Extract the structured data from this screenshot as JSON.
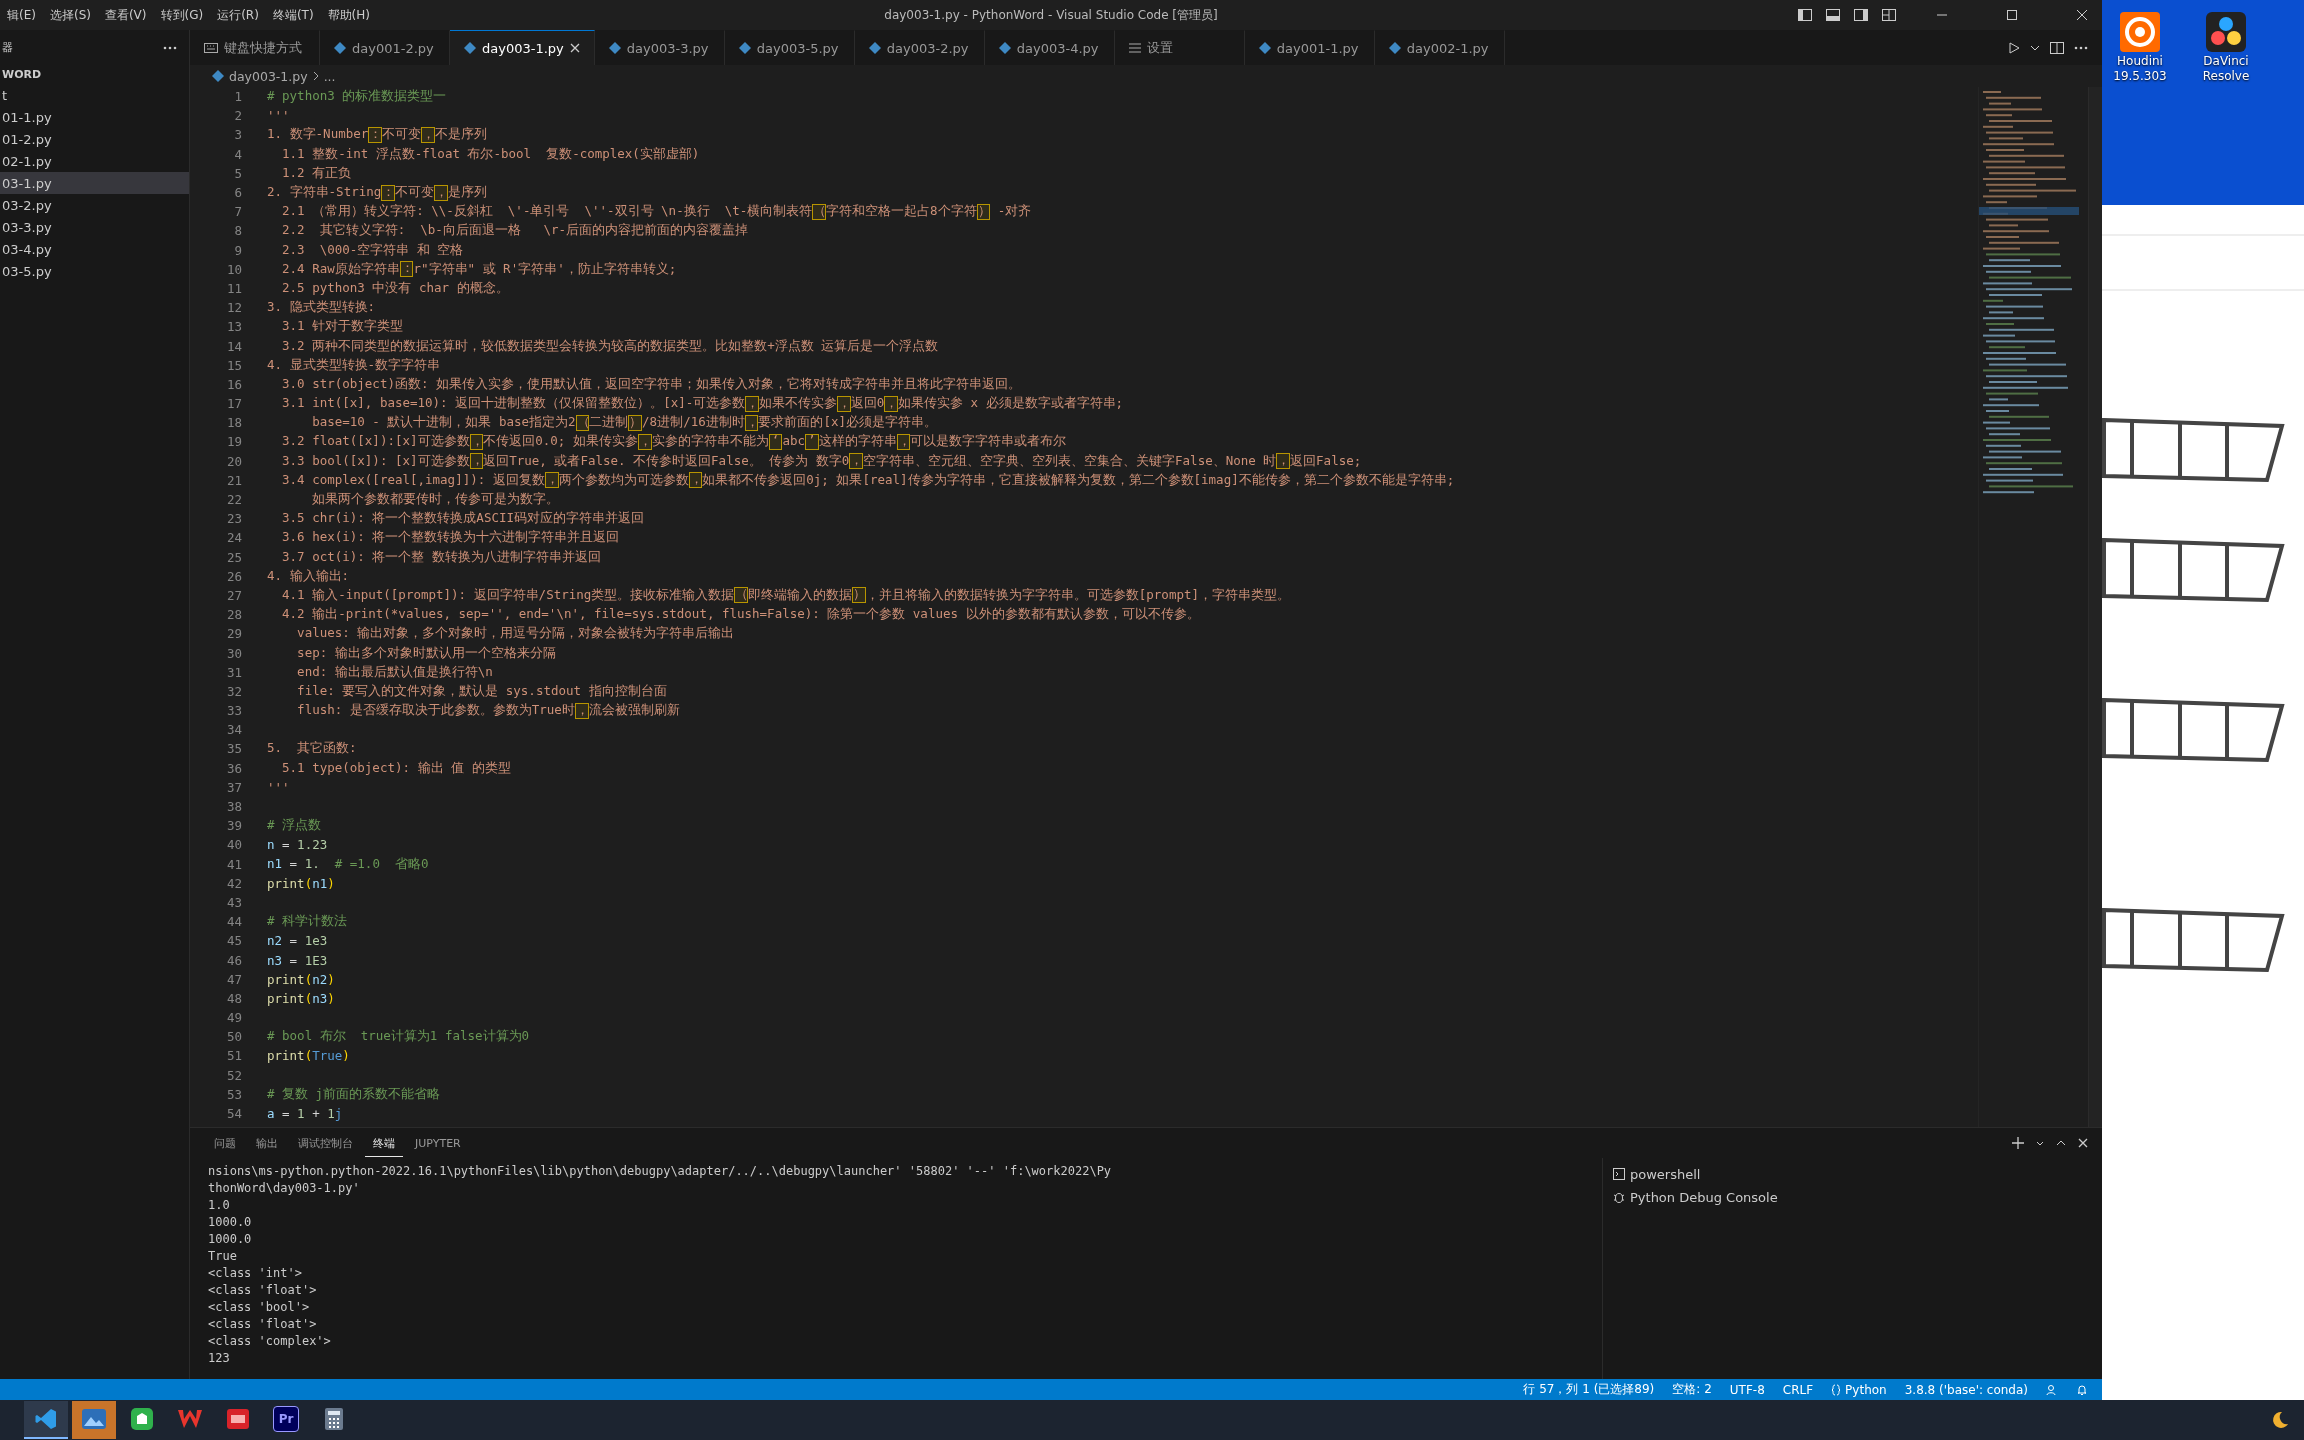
{
  "titlebar": {
    "menu": [
      "辑(E)",
      "选择(S)",
      "查看(V)",
      "转到(G)",
      "运行(R)",
      "终端(T)",
      "帮助(H)"
    ],
    "title": "day003-1.py - PythonWord - Visual Studio Code [管理员]"
  },
  "sidebar": {
    "header": "器",
    "folder": "WORD",
    "items": [
      {
        "label": "t",
        "selected": false
      },
      {
        "label": "01-1.py",
        "selected": false
      },
      {
        "label": "01-2.py",
        "selected": false
      },
      {
        "label": "02-1.py",
        "selected": false
      },
      {
        "label": "03-1.py",
        "selected": true
      },
      {
        "label": "03-2.py",
        "selected": false
      },
      {
        "label": "03-3.py",
        "selected": false
      },
      {
        "label": "03-4.py",
        "selected": false
      },
      {
        "label": "03-5.py",
        "selected": false
      }
    ]
  },
  "tabs": [
    {
      "label": "键盘快捷方式",
      "kind": "keyboard",
      "selected": false
    },
    {
      "label": "day001-2.py",
      "kind": "python",
      "selected": false
    },
    {
      "label": "day003-1.py",
      "kind": "python",
      "selected": true
    },
    {
      "label": "day003-3.py",
      "kind": "python",
      "selected": false
    },
    {
      "label": "day003-5.py",
      "kind": "python",
      "selected": false
    },
    {
      "label": "day003-2.py",
      "kind": "python",
      "selected": false
    },
    {
      "label": "day003-4.py",
      "kind": "python",
      "selected": false
    },
    {
      "label": "设置",
      "kind": "settings",
      "selected": false
    },
    {
      "label": "day001-1.py",
      "kind": "python",
      "selected": false
    },
    {
      "label": "day002-1.py",
      "kind": "python",
      "selected": false
    }
  ],
  "breadcrumb": {
    "file": "day003-1.py",
    "rest": "..."
  },
  "editor": {
    "lines": [
      {
        "num": "1",
        "kind": "comment",
        "tokens": [
          {
            "kind": "comment",
            "text": "# python3 的标准数据类型一"
          }
        ]
      },
      {
        "num": "2",
        "kind": "docstring",
        "tokens": [
          {
            "kind": "text",
            "text": "'''"
          }
        ]
      },
      {
        "num": "3",
        "kind": "docstring",
        "tokens": [
          {
            "kind": "text",
            "text": "1. 数字-Number"
          },
          {
            "kind": "lead_mark",
            "text": "：不可变"
          },
          {
            "kind": "lead_mark",
            "text": "，不是序列"
          }
        ]
      },
      {
        "num": "4",
        "kind": "docstring",
        "tokens": [
          {
            "kind": "text",
            "text": "  1.1 整数-int 浮点数-float 布尔-bool  复数-complex(实部虚部)"
          }
        ]
      },
      {
        "num": "5",
        "kind": "docstring",
        "tokens": [
          {
            "kind": "text",
            "text": "  1.2 有正负"
          }
        ]
      },
      {
        "num": "6",
        "kind": "docstring",
        "tokens": [
          {
            "kind": "text",
            "text": "2. 字符串-String"
          },
          {
            "kind": "lead_mark",
            "text": "：不可变"
          },
          {
            "kind": "lead_mark",
            "text": "，是序列"
          }
        ]
      },
      {
        "num": "7",
        "kind": "docstring",
        "tokens": [
          {
            "kind": "text",
            "text": "  2.1 （常用）转义字符: \\\\-反斜杠  \\'-单引号  \\''-双引号 \\n-换行  \\t-横向制表符"
          },
          {
            "kind": "lead_mark",
            "text": "（字符和空格一起占8个字符"
          },
          {
            "kind": "lead_mark",
            "text": "） -对齐"
          }
        ]
      },
      {
        "num": "8",
        "kind": "docstring",
        "tokens": [
          {
            "kind": "text",
            "text": "  2.2  其它转义字符:  \\b-向后面退一格   \\r-后面的内容把前面的内容覆盖掉"
          }
        ]
      },
      {
        "num": "9",
        "kind": "docstring",
        "tokens": [
          {
            "kind": "text",
            "text": "  2.3  \\000-空字符串 和 空格"
          }
        ]
      },
      {
        "num": "10",
        "kind": "docstring",
        "tokens": [
          {
            "kind": "text",
            "text": "  2.4 Raw原始字符串"
          },
          {
            "kind": "lead_mark",
            "text": "：r\"字符串\" 或 R'字符串'，防止字符串转义;"
          }
        ]
      },
      {
        "num": "11",
        "kind": "docstring",
        "tokens": [
          {
            "kind": "text",
            "text": "  2.5 python3 中没有 char 的概念。"
          }
        ]
      },
      {
        "num": "12",
        "kind": "docstring",
        "tokens": [
          {
            "kind": "text",
            "text": "3. 隐式类型转换:"
          }
        ]
      },
      {
        "num": "13",
        "kind": "docstring",
        "tokens": [
          {
            "kind": "text",
            "text": "  3.1 针对于数字类型"
          }
        ]
      },
      {
        "num": "14",
        "kind": "docstring",
        "tokens": [
          {
            "kind": "text",
            "text": "  3.2 两种不同类型的数据运算时，较低数据类型会转换为较高的数据类型。比如整数+浮点数 运算后是一个浮点数"
          }
        ]
      },
      {
        "num": "15",
        "kind": "docstring",
        "tokens": [
          {
            "kind": "text",
            "text": "4. 显式类型转换-数字字符串"
          }
        ]
      },
      {
        "num": "16",
        "kind": "docstring",
        "tokens": [
          {
            "kind": "text",
            "text": "  3.0 str(object)函数: 如果传入实参，使用默认值，返回空字符串；如果传入对象，它将对转成字符串并且将此字符串返回。"
          }
        ]
      },
      {
        "num": "17",
        "kind": "docstring",
        "tokens": [
          {
            "kind": "text",
            "text": "  3.1 int([x], base=10): 返回十进制整数（仅保留整数位）。[x]-可选参数"
          },
          {
            "kind": "lead_mark",
            "text": "，如果不传实参"
          },
          {
            "kind": "lead_mark",
            "text": "，返回0"
          },
          {
            "kind": "lead_mark",
            "text": "，如果传实参 x 必须是数字或者字符串;"
          }
        ]
      },
      {
        "num": "18",
        "kind": "docstring",
        "tokens": [
          {
            "kind": "text",
            "text": "      base=10 - 默认十进制，如果 base指定为2"
          },
          {
            "kind": "lead_mark",
            "text": "（二进制"
          },
          {
            "kind": "lead_mark",
            "text": "）/8进制/16进制时"
          },
          {
            "kind": "lead_mark",
            "text": "，要求前面的[x]必须是字符串。"
          }
        ]
      },
      {
        "num": "19",
        "kind": "docstring",
        "tokens": [
          {
            "kind": "text",
            "text": "  3.2 float([x]):[x]可选参数"
          },
          {
            "kind": "lead_mark",
            "text": "，不传返回0.0; 如果传实参"
          },
          {
            "kind": "lead_mark",
            "text": "，实参的字符串不能为"
          },
          {
            "kind": "lead_mark",
            "text": "‘abc"
          },
          {
            "kind": "lead_mark",
            "text": "’这样的字符串"
          },
          {
            "kind": "lead_mark",
            "text": "，可以是数字字符串或者布尔"
          }
        ]
      },
      {
        "num": "20",
        "kind": "docstring",
        "tokens": [
          {
            "kind": "text",
            "text": "  3.3 bool([x]): [x]可选参数"
          },
          {
            "kind": "lead_mark",
            "text": "，返回True, 或者False. 不传参时返回False。 传参为 数字0"
          },
          {
            "kind": "lead_mark",
            "text": "，空字符串、空元组、空字典、空列表、空集合、关键字False、None 时"
          },
          {
            "kind": "lead_mark",
            "text": "，返回False;"
          }
        ]
      },
      {
        "num": "21",
        "kind": "docstring",
        "tokens": [
          {
            "kind": "text",
            "text": "  3.4 complex([real[,imag]]): 返回复数"
          },
          {
            "kind": "lead_mark",
            "text": "，两个参数均为可选参数"
          },
          {
            "kind": "lead_mark",
            "text": "，如果都不传参返回0j; 如果[real]传参为字符串，它直接被解释为复数，第二个参数[imag]不能传参，第二个参数不能是字符串;"
          }
        ]
      },
      {
        "num": "22",
        "kind": "docstring",
        "tokens": [
          {
            "kind": "text",
            "text": "      如果两个参数都要传时，传参可是为数字。"
          }
        ]
      },
      {
        "num": "23",
        "kind": "docstring",
        "tokens": [
          {
            "kind": "text",
            "text": "  3.5 chr(i): 将一个整数转换成ASCII码对应的字符串并返回"
          }
        ]
      },
      {
        "num": "24",
        "kind": "docstring",
        "tokens": [
          {
            "kind": "text",
            "text": "  3.6 hex(i): 将一个整数转换为十六进制字符串并且返回"
          }
        ]
      },
      {
        "num": "25",
        "kind": "docstring",
        "tokens": [
          {
            "kind": "text",
            "text": "  3.7 oct(i): 将一个整 数转换为八进制字符串并返回"
          }
        ]
      },
      {
        "num": "26",
        "kind": "docstring",
        "tokens": [
          {
            "kind": "text",
            "text": "4. 输入输出:"
          }
        ]
      },
      {
        "num": "27",
        "kind": "docstring",
        "tokens": [
          {
            "kind": "text",
            "text": "  4.1 输入-input([prompt]): 返回字符串/String类型。接收标准输入数据"
          },
          {
            "kind": "lead_mark",
            "text": "（即终端输入的数据"
          },
          {
            "kind": "lead_mark",
            "text": "），并且将输入的数据转换为字字符串。可选参数[prompt]，字符串类型。"
          }
        ]
      },
      {
        "num": "28",
        "kind": "docstring",
        "tokens": [
          {
            "kind": "text",
            "text": "  4.2 输出-print(*values, sep='', end='\\n', file=sys.stdout, flush=False): 除第一个参数 values 以外的参数都有默认参数，可以不传参。"
          }
        ]
      },
      {
        "num": "29",
        "kind": "docstring",
        "tokens": [
          {
            "kind": "text",
            "text": "    values: 输出对象，多个对象时，用逗号分隔，对象会被转为字符串后输出"
          }
        ]
      },
      {
        "num": "30",
        "kind": "docstring",
        "tokens": [
          {
            "kind": "text",
            "text": "    sep: 输出多个对象时默认用一个空格来分隔"
          }
        ]
      },
      {
        "num": "31",
        "kind": "docstring",
        "tokens": [
          {
            "kind": "text",
            "text": "    end: 输出最后默认值是换行符\\n"
          }
        ]
      },
      {
        "num": "32",
        "kind": "docstring",
        "tokens": [
          {
            "kind": "text",
            "text": "    file: 要写入的文件对象，默认是 sys.stdout 指向控制台面"
          }
        ]
      },
      {
        "num": "33",
        "kind": "docstring",
        "tokens": [
          {
            "kind": "text",
            "text": "    flush: 是否缓存取决于此参数。参数为True时"
          },
          {
            "kind": "lead_mark",
            "text": "，流会被强制刷新"
          }
        ]
      },
      {
        "num": "34",
        "kind": "blank"
      },
      {
        "num": "35",
        "kind": "docstring",
        "tokens": [
          {
            "kind": "text",
            "text": "5.  其它函数:"
          }
        ]
      },
      {
        "num": "36",
        "kind": "docstring",
        "tokens": [
          {
            "kind": "text",
            "text": "  5.1 type(object): 输出 值 的类型"
          }
        ]
      },
      {
        "num": "37",
        "kind": "docstring",
        "tokens": [
          {
            "kind": "text",
            "text": "'''"
          }
        ]
      },
      {
        "num": "38",
        "kind": "blank"
      },
      {
        "num": "39",
        "kind": "comment",
        "tokens": [
          {
            "kind": "comment",
            "text": "# 浮点数"
          }
        ]
      },
      {
        "num": "40",
        "kind": "code",
        "tokens": [
          {
            "kind": "var",
            "text": "n"
          },
          {
            "kind": "op",
            "text": " = "
          },
          {
            "kind": "num",
            "text": "1.23"
          }
        ]
      },
      {
        "num": "41",
        "kind": "code",
        "tokens": [
          {
            "kind": "var",
            "text": "n1"
          },
          {
            "kind": "op",
            "text": " = "
          },
          {
            "kind": "num",
            "text": "1."
          },
          {
            "kind": "comment",
            "text": "  # =1.0  省略0"
          }
        ]
      },
      {
        "num": "42",
        "kind": "code",
        "tokens": [
          {
            "kind": "func",
            "text": "print"
          },
          {
            "kind": "paren",
            "text": "("
          },
          {
            "kind": "var",
            "text": "n1"
          },
          {
            "kind": "paren",
            "text": ")"
          }
        ]
      },
      {
        "num": "43",
        "kind": "blank"
      },
      {
        "num": "44",
        "kind": "comment",
        "tokens": [
          {
            "kind": "comment",
            "text": "# 科学计数法"
          }
        ]
      },
      {
        "num": "45",
        "kind": "code",
        "tokens": [
          {
            "kind": "var",
            "text": "n2"
          },
          {
            "kind": "op",
            "text": " = "
          },
          {
            "kind": "num",
            "text": "1e3"
          }
        ]
      },
      {
        "num": "46",
        "kind": "code",
        "tokens": [
          {
            "kind": "var",
            "text": "n3"
          },
          {
            "kind": "op",
            "text": " = "
          },
          {
            "kind": "num",
            "text": "1E3"
          }
        ]
      },
      {
        "num": "47",
        "kind": "code",
        "tokens": [
          {
            "kind": "func",
            "text": "print"
          },
          {
            "kind": "paren",
            "text": "("
          },
          {
            "kind": "var",
            "text": "n2"
          },
          {
            "kind": "paren",
            "text": ")"
          }
        ]
      },
      {
        "num": "48",
        "kind": "code",
        "tokens": [
          {
            "kind": "func",
            "text": "print"
          },
          {
            "kind": "paren",
            "text": "("
          },
          {
            "kind": "var",
            "text": "n3"
          },
          {
            "kind": "paren",
            "text": ")"
          }
        ]
      },
      {
        "num": "49",
        "kind": "blank"
      },
      {
        "num": "50",
        "kind": "comment",
        "tokens": [
          {
            "kind": "comment",
            "text": "# bool 布尔  true计算为1 false计算为0"
          }
        ]
      },
      {
        "num": "51",
        "kind": "code",
        "tokens": [
          {
            "kind": "func",
            "text": "print"
          },
          {
            "kind": "paren",
            "text": "("
          },
          {
            "kind": "const",
            "text": "True"
          },
          {
            "kind": "paren",
            "text": ")"
          }
        ]
      },
      {
        "num": "52",
        "kind": "blank"
      },
      {
        "num": "53",
        "kind": "comment",
        "tokens": [
          {
            "kind": "comment",
            "text": "# 复数 j前面的系数不能省略"
          }
        ]
      },
      {
        "num": "54",
        "kind": "code",
        "tokens": [
          {
            "kind": "var",
            "text": "a"
          },
          {
            "kind": "op",
            "text": " = "
          },
          {
            "kind": "num",
            "text": "1"
          },
          {
            "kind": "op",
            "text": " + "
          },
          {
            "kind": "num",
            "text": "1"
          },
          {
            "kind": "const",
            "text": "j"
          }
        ]
      }
    ]
  },
  "panel": {
    "tabs": [
      {
        "label": "问题",
        "selected": false
      },
      {
        "label": "输出",
        "selected": false
      },
      {
        "label": "调试控制台",
        "selected": false
      },
      {
        "label": "终端",
        "selected": true
      },
      {
        "label": "JUPYTER",
        "selected": false
      }
    ],
    "terminal_lines": [
      "nsions\\ms-python.python-2022.16.1\\pythonFiles\\lib\\python\\debugpy\\adapter/../..\\debugpy\\launcher' '58802' '--' 'f:\\work2022\\Py",
      "thonWord\\day003-1.py'",
      "1.0",
      "1000.0",
      "1000.0",
      "True",
      "<class 'int'>",
      "<class 'float'>",
      "<class 'bool'>",
      "<class 'float'>",
      "<class 'complex'>",
      "123"
    ],
    "terminals": [
      {
        "label": "powershell",
        "kind": "shell"
      },
      {
        "label": "Python Debug Console",
        "kind": "debug"
      }
    ]
  },
  "status_bar": {
    "items": [
      "行 57，列 1 (已选择89)",
      "空格: 2",
      "UTF-8",
      "CRLF",
      "Python",
      "3.8.8 ('base': conda)"
    ]
  },
  "desktop": {
    "icons": [
      {
        "kind": "houdini",
        "lines": [
          "Houdini",
          "19.5.303"
        ]
      },
      {
        "kind": "davinci",
        "lines": [
          "DaVinci",
          "Resolve"
        ]
      }
    ]
  },
  "taskbar": {
    "apps": [
      {
        "kind": "vscode",
        "selected": true,
        "attention": false
      },
      {
        "kind": "photo",
        "selected": false,
        "attention": true
      },
      {
        "kind": "green",
        "selected": false,
        "attention": false
      },
      {
        "kind": "wps",
        "selected": false,
        "attention": false
      },
      {
        "kind": "red",
        "selected": false,
        "attention": false
      },
      {
        "kind": "premiere",
        "label": "Pr",
        "selected": false,
        "attention": false
      },
      {
        "kind": "calculator",
        "selected": false,
        "attention": false
      }
    ]
  }
}
